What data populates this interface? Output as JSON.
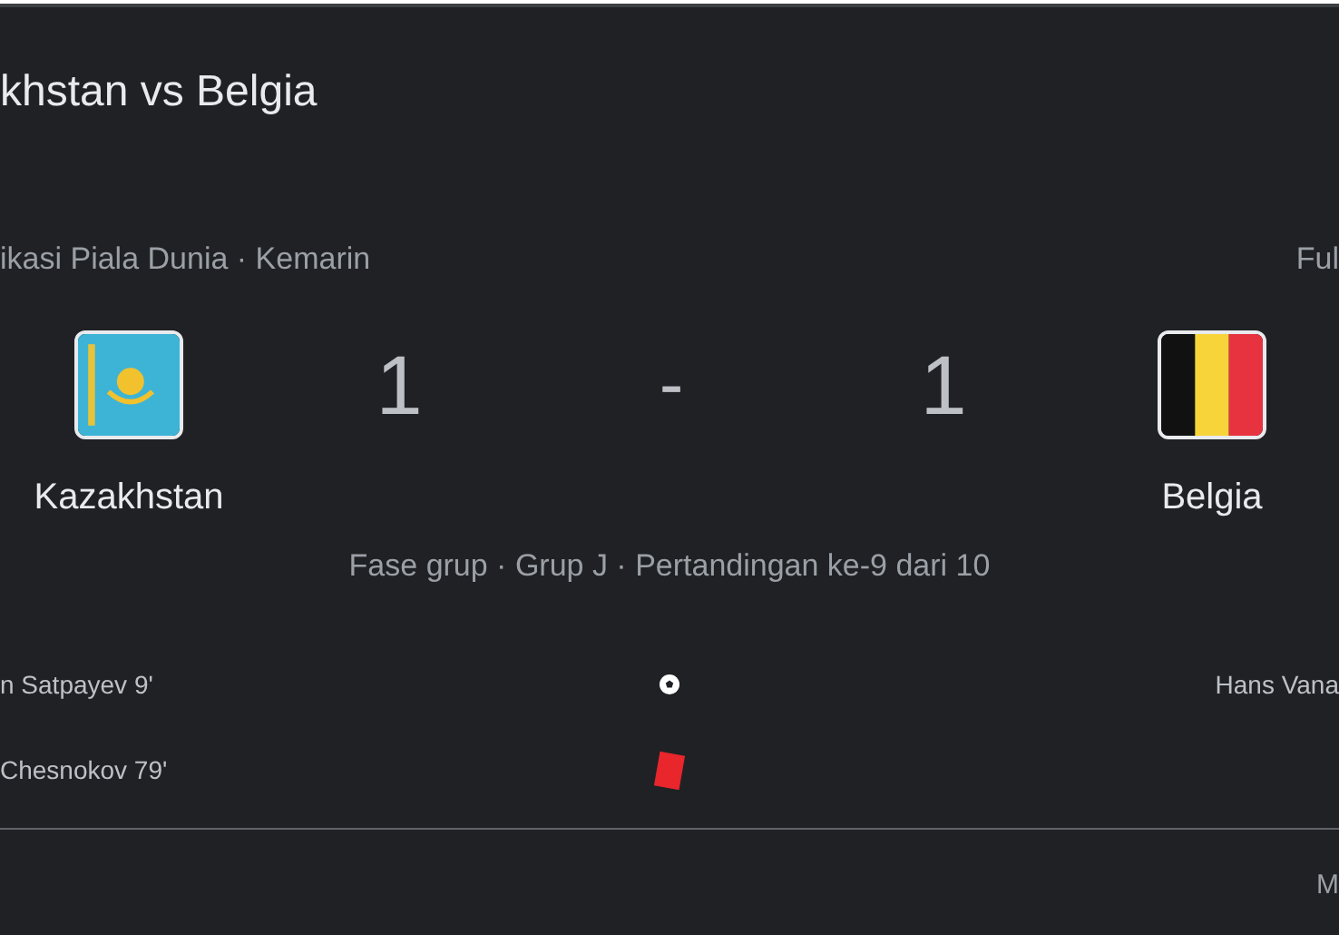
{
  "title": "khstan vs Belgia",
  "meta": "ikasi Piala Dunia · Kemarin",
  "status": "Ful",
  "home": {
    "name": "Kazakhstan",
    "score": "1",
    "kind": "kazakhstan"
  },
  "separator": "-",
  "away": {
    "name": "Belgia",
    "score": "1",
    "kind": "belgium"
  },
  "stage": "Fase grup · Grup J · Pertandingan ke-9 dari 10",
  "events": [
    {
      "kind": "goal",
      "home": "n Satpayev 9'",
      "away": "Hans Vana"
    },
    {
      "kind": "red_card",
      "home": "Chesnokov 79'"
    }
  ],
  "footer": "M"
}
